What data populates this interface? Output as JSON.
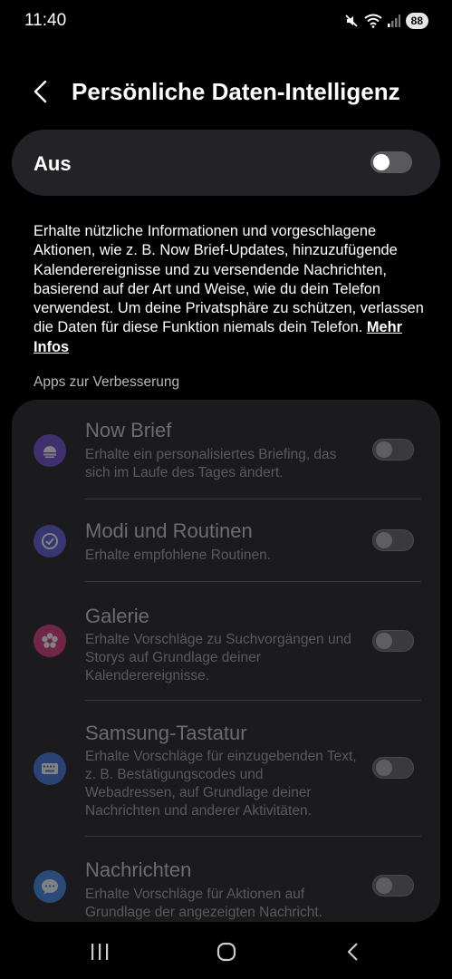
{
  "status_bar": {
    "time": "11:40",
    "battery": "88",
    "icons": [
      "mute-icon",
      "wifi-icon",
      "signal-icon",
      "battery-icon"
    ]
  },
  "header": {
    "back_icon": "chevron-left-icon",
    "title": "Persönliche Daten-Intelligenz"
  },
  "master_switch": {
    "label": "Aus",
    "state": "off"
  },
  "description": {
    "text": "Erhalte nützliche Informationen und vorgeschlagene Aktionen, wie z. B. Now Brief-Updates, hinzuzufügende Kalenderereignisse und zu versendende Nachrichten, basierend auf der Art und Weise, wie du dein Telefon verwendest. Um deine Privatsphäre zu schützen, verlassen die Daten für diese Funktion niemals dein Telefon.",
    "link": "Mehr Infos"
  },
  "section": {
    "title": "Apps zur Verbesserung"
  },
  "apps": [
    {
      "title": "Now Brief",
      "subtitle": "Erhalte ein personalisiertes Briefing, das sich im Laufe des Tages ändert.",
      "icon": "now-brief-icon",
      "color": "#6a4bd0",
      "state": "off"
    },
    {
      "title": "Modi und Routinen",
      "subtitle": "Erhalte empfohlene Routinen.",
      "icon": "modes-routines-icon",
      "color": "#5a56d8",
      "state": "off"
    },
    {
      "title": "Galerie",
      "subtitle": "Erhalte Vorschläge zu Suchvorgängen und Storys auf Grundlage deiner Kalenderereignisse.",
      "icon": "gallery-icon",
      "color": "#d9357a",
      "state": "off"
    },
    {
      "title": "Samsung-Tastatur",
      "subtitle": "Erhalte Vorschläge für einzugebenden Text, z. B. Bestätigungscodes und Webadressen, auf Grundlage deiner Nachrichten und anderer Aktivitäten.",
      "icon": "keyboard-icon",
      "color": "#3f73e0",
      "state": "off"
    },
    {
      "title": "Nachrichten",
      "subtitle": "Erhalte Vorschläge für Aktionen auf Grundlage der angezeigten Nachricht.",
      "icon": "messages-icon",
      "color": "#3f86e8",
      "state": "off"
    }
  ],
  "nav_bar": {
    "buttons": [
      "recents-icon",
      "home-icon",
      "back-icon"
    ]
  }
}
